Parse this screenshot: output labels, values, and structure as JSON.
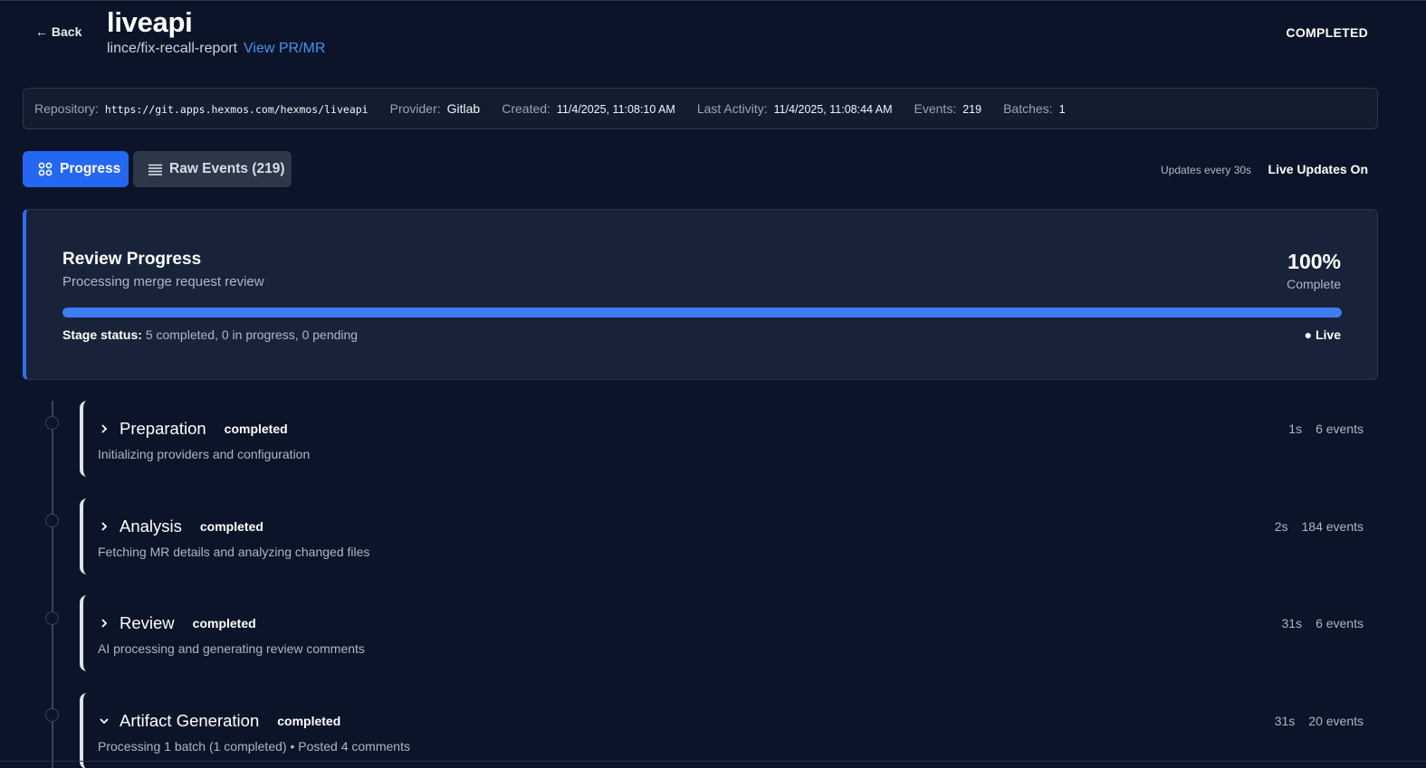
{
  "header": {
    "back_label": "← Back",
    "title": "liveapi",
    "branch": "lince/fix-recall-report",
    "pr_link_label": "View PR/MR",
    "status": "COMPLETED"
  },
  "info": {
    "repository_label": "Repository:",
    "repository": "https://git.apps.hexmos.com/hexmos/liveapi",
    "provider_label": "Provider:",
    "provider": "Gitlab",
    "created_label": "Created:",
    "created": "11/4/2025, 11:08:10 AM",
    "last_activity_label": "Last Activity:",
    "last_activity": "11/4/2025, 11:08:44 AM",
    "events_label": "Events:",
    "events": "219",
    "batches_label": "Batches:",
    "batches": "1"
  },
  "tabs": {
    "progress_label": "Progress",
    "raw_label": "Raw Events (219)",
    "updates_note": "Updates every 30s",
    "live_updates": "Live Updates On"
  },
  "progress": {
    "title": "Review Progress",
    "subtitle": "Processing merge request review",
    "percent_label": "100%",
    "percent_value": 100,
    "complete_label": "Complete",
    "stage_status_label": "Stage status:",
    "stage_status": "5 completed, 0 in progress, 0 pending",
    "live_label": "● Live"
  },
  "stages": [
    {
      "name": "Preparation",
      "status": "completed",
      "description": "Initializing providers and configuration",
      "duration": "1s",
      "events": "6 events",
      "expanded": false
    },
    {
      "name": "Analysis",
      "status": "completed",
      "description": "Fetching MR details and analyzing changed files",
      "duration": "2s",
      "events": "184 events",
      "expanded": false
    },
    {
      "name": "Review",
      "status": "completed",
      "description": "AI processing and generating review comments",
      "duration": "31s",
      "events": "6 events",
      "expanded": false
    },
    {
      "name": "Artifact Generation",
      "status": "completed",
      "description": "Processing 1 batch (1 completed) • Posted 4 comments",
      "duration": "31s",
      "events": "20 events",
      "expanded": true
    }
  ],
  "colors": {
    "background": "#0b1428",
    "accent": "#2467f0",
    "progress_fill": "#3d7ef2",
    "link": "#4a90f0"
  }
}
